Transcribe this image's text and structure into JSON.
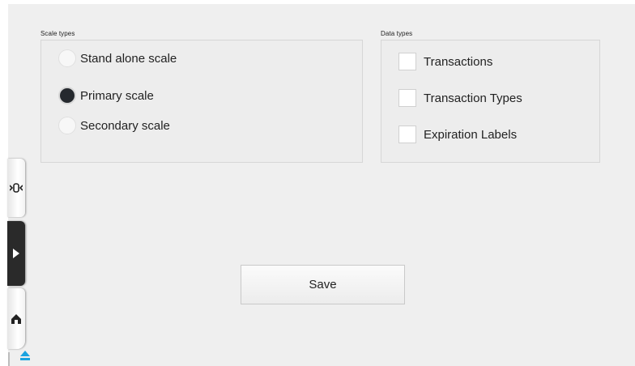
{
  "scale_types": {
    "title": "Scale types",
    "options": [
      {
        "label": "Stand alone scale",
        "selected": false
      },
      {
        "label": "Primary scale",
        "selected": true
      },
      {
        "label": "Secondary scale",
        "selected": false
      }
    ]
  },
  "data_types": {
    "title": "Data types",
    "options": [
      {
        "label": "Transactions",
        "checked": false
      },
      {
        "label": "Transaction Types",
        "checked": false
      },
      {
        "label": "Expiration Labels",
        "checked": false
      }
    ]
  },
  "actions": {
    "save_label": "Save"
  },
  "dock": {
    "icons": [
      "scale-icon",
      "play-icon",
      "home-icon",
      "eject-icon"
    ]
  },
  "colors": {
    "background": "#efefef",
    "radio_selected": "#25292e",
    "accent": "#1aa3e0"
  }
}
